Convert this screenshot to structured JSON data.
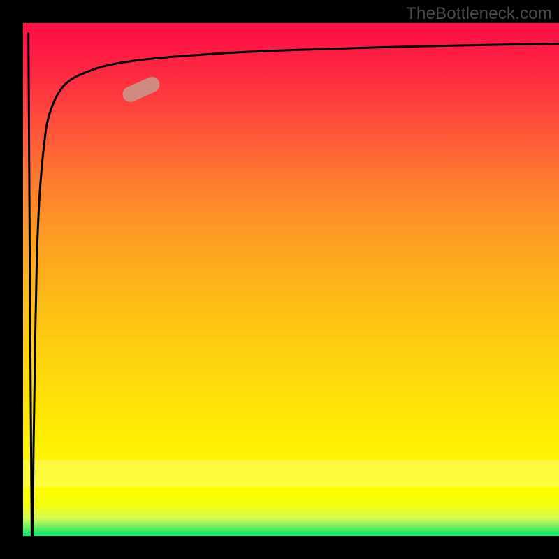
{
  "attribution": "TheBottleneck.com",
  "chart_data": {
    "type": "line",
    "title": "",
    "xlabel": "",
    "ylabel": "",
    "xlim": [
      0,
      100
    ],
    "ylim": [
      0,
      100
    ],
    "gradient_background": {
      "orientation": "vertical",
      "colors_from_top": [
        "#fe1346",
        "#fe9826",
        "#fef802",
        "#00e66e"
      ],
      "meaning": "red-yellow-green heat gradient"
    },
    "white_band_y_range": [
      9.5,
      14.8
    ],
    "series": [
      {
        "name": "bottleneck-curve",
        "x": [
          1.0,
          1.6,
          2.0,
          2.3,
          2.6,
          3.0,
          3.5,
          4.0,
          4.5,
          5.5,
          7.0,
          9.0,
          12.0,
          16.0,
          22.0,
          30.0,
          42.0,
          58.0,
          75.0,
          90.0,
          100.0
        ],
        "y": [
          98.0,
          2.0,
          20.0,
          40.0,
          55.0,
          65.0,
          72.0,
          77.0,
          80.5,
          84.0,
          87.0,
          89.0,
          90.5,
          91.8,
          92.8,
          93.6,
          94.4,
          95.0,
          95.5,
          95.8,
          96.0
        ]
      }
    ],
    "marker": {
      "x": 22.0,
      "y": 87.0,
      "shape": "pill",
      "fill": "#cf8b80",
      "rotation_deg": -24
    }
  },
  "colors": {
    "page_bg": "#000000",
    "curve_stroke": "#000000",
    "marker_fill": "#cf8b80",
    "attribution_text": "#4a4a4a"
  }
}
